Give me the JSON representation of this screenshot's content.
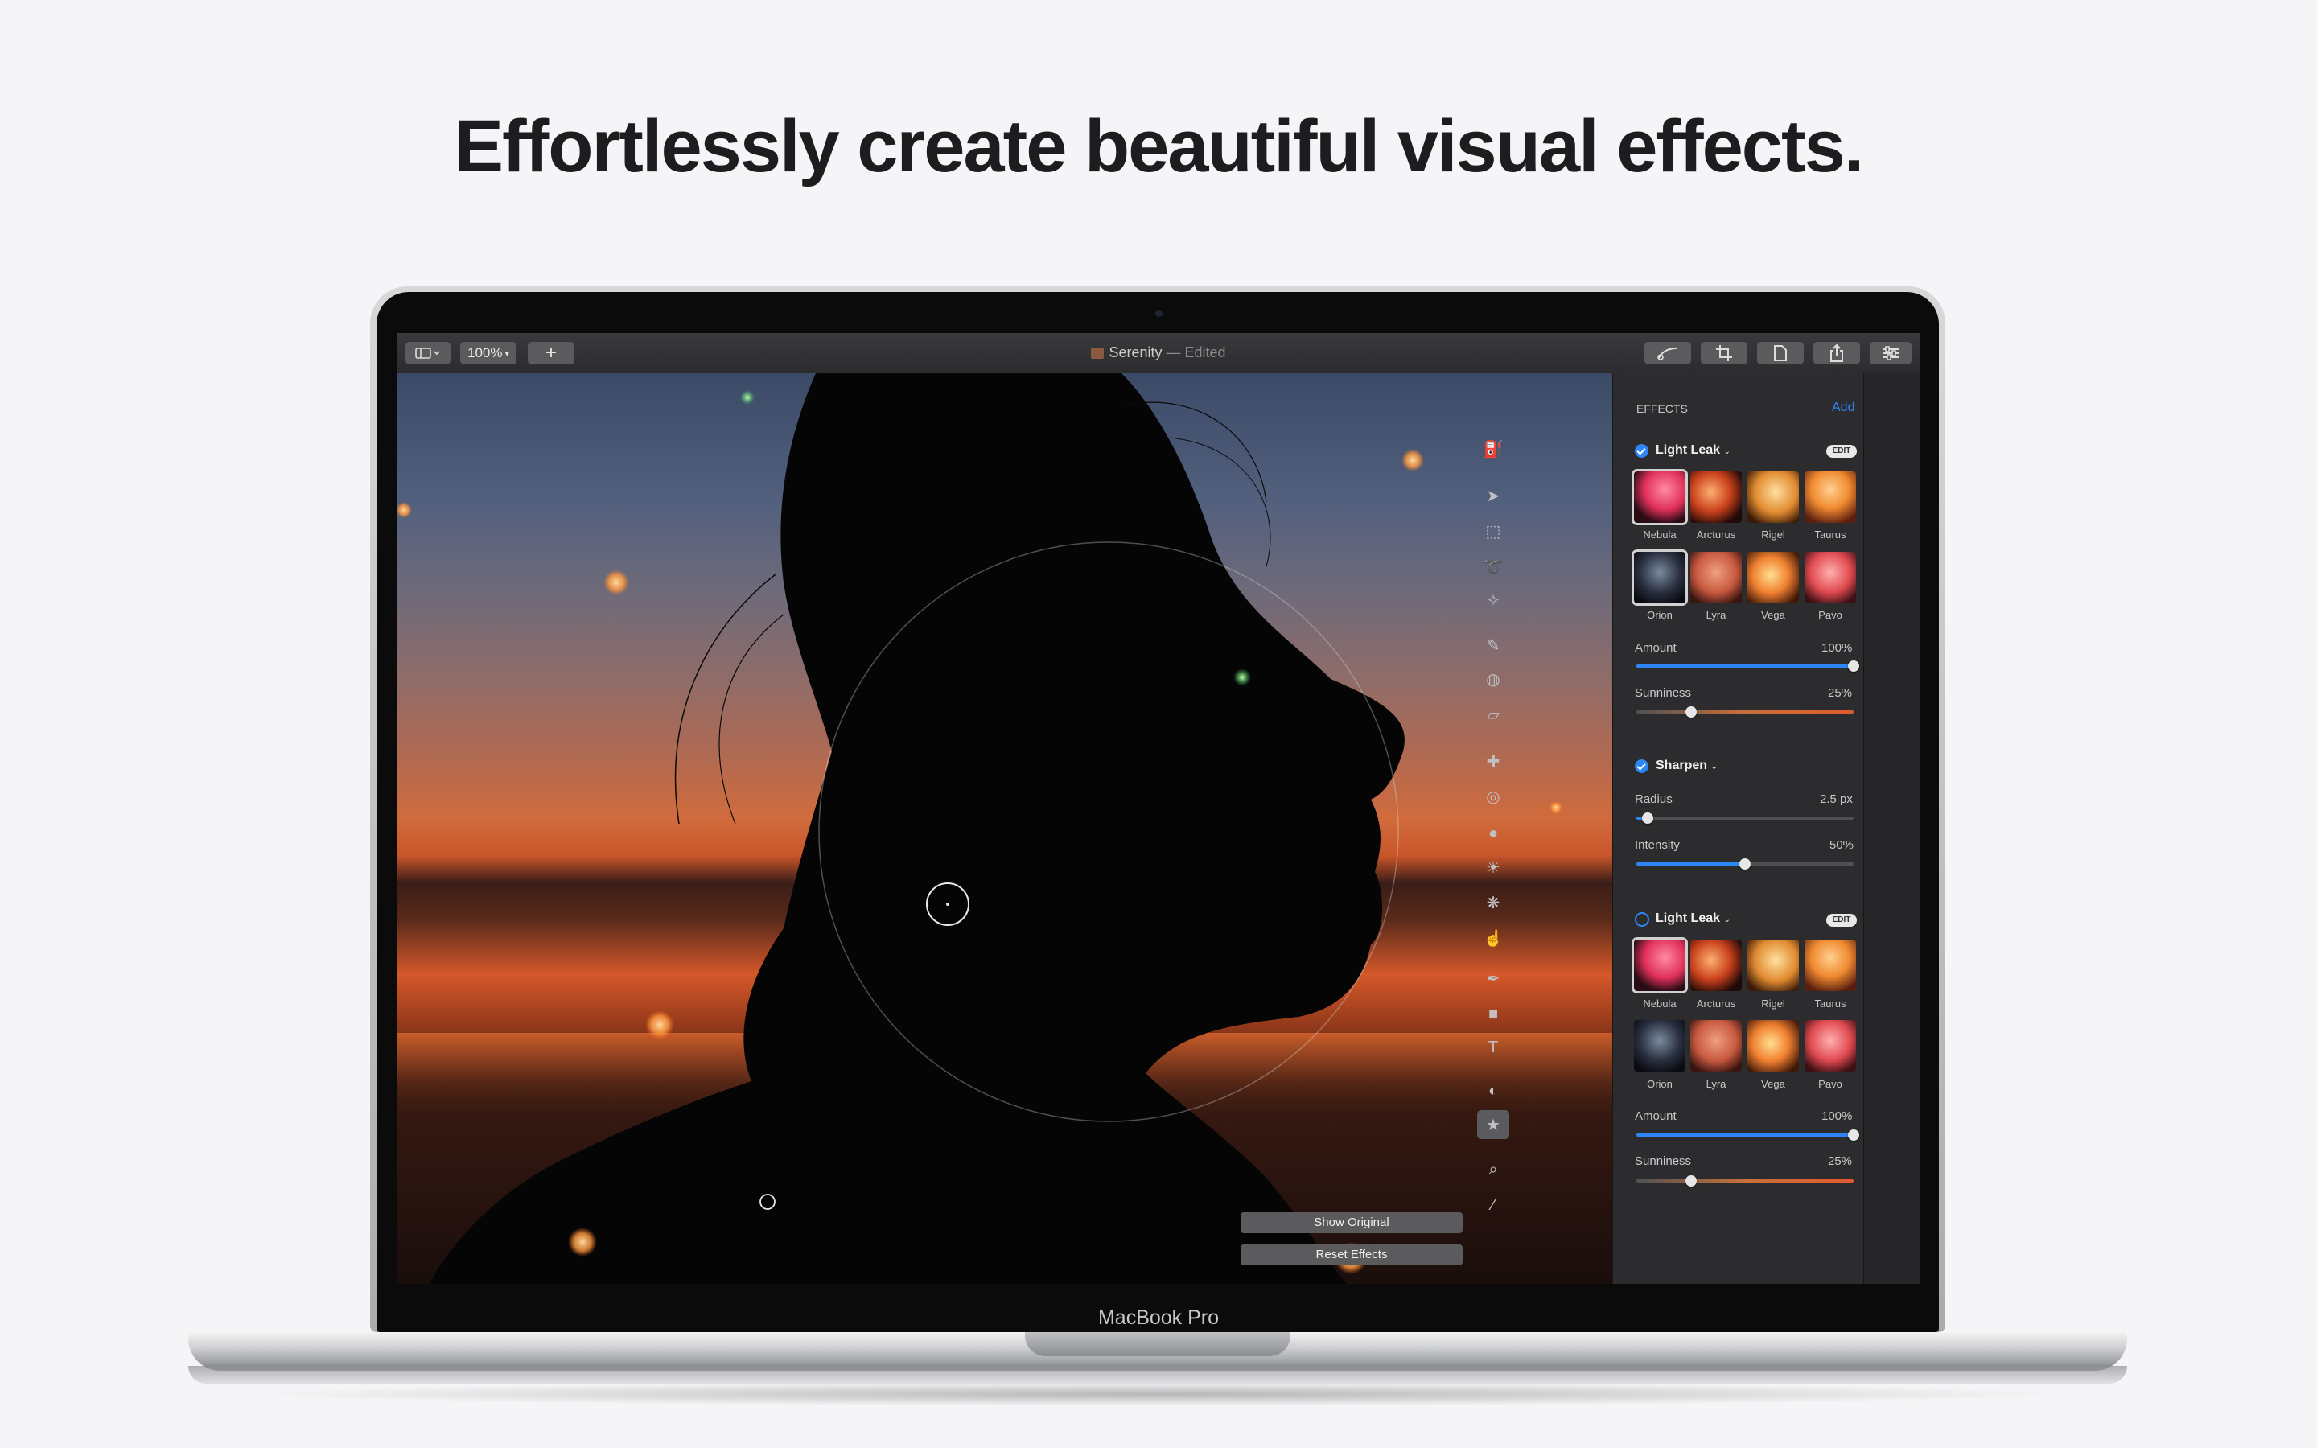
{
  "headline": "Effortlessly create beautiful visual effects.",
  "device_label": "MacBook Pro",
  "window": {
    "zoom": "100%",
    "add_label": "+",
    "doc_title": "Serenity",
    "doc_status": "— Edited"
  },
  "effects": {
    "section_title": "EFFECTS",
    "add_label": "Add",
    "edit_badge": "EDIT",
    "light_leak_1": {
      "name": "Light Leak",
      "enabled": true,
      "thumbnails": [
        "Nebula",
        "Arcturus",
        "Rigel",
        "Taurus",
        "Orion",
        "Lyra",
        "Vega",
        "Pavo"
      ],
      "selected": "Orion",
      "amount_label": "Amount",
      "amount_value": "100%",
      "amount_level": 1.0,
      "sunniness_label": "Sunniness",
      "sunniness_value": "25%",
      "sunniness_level": 0.25
    },
    "sharpen": {
      "name": "Sharpen",
      "enabled": true,
      "radius_label": "Radius",
      "radius_value": "2.5 px",
      "radius_level": 0.05,
      "intensity_label": "Intensity",
      "intensity_value": "50%",
      "intensity_level": 0.5
    },
    "light_leak_2": {
      "name": "Light Leak",
      "enabled": false,
      "thumbnails": [
        "Nebula",
        "Arcturus",
        "Rigel",
        "Taurus",
        "Orion",
        "Lyra",
        "Vega",
        "Pavo"
      ],
      "selected": "Nebula",
      "amount_label": "Amount",
      "amount_value": "100%",
      "amount_level": 1.0,
      "sunniness_label": "Sunniness",
      "sunniness_value": "25%",
      "sunniness_level": 0.25
    },
    "show_original": "Show Original",
    "reset_effects": "Reset Effects"
  },
  "tools": [
    "paint-bucket-icon",
    "arrow-pointer-icon",
    "rect-select-icon",
    "lasso-icon",
    "magic-select-icon",
    "brush-icon",
    "bucket-icon",
    "eraser-icon",
    "repair-icon",
    "clone-icon",
    "blur-icon",
    "light-icon",
    "sponge-icon",
    "smudge-icon",
    "pen-icon",
    "shape-icon",
    "text-icon",
    "color-adjust-icon",
    "effects-star-icon",
    "zoom-icon",
    "eyedropper-icon"
  ],
  "colors": {
    "accent": "#2e86f6",
    "panel": "#2c2c2e",
    "background": "#f5f5f7"
  }
}
